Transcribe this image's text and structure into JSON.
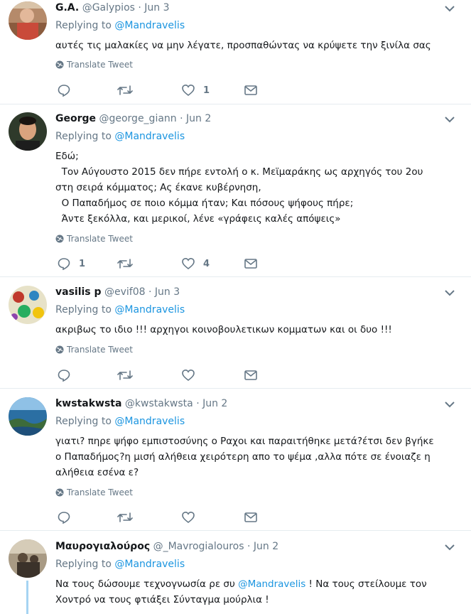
{
  "translate_label": "Translate Tweet",
  "replying_prefix": "Replying to",
  "tweets": [
    {
      "name": "G.A.",
      "handle": "@Galypios",
      "date": "Jun 3",
      "reply_to": "@Mandravelis",
      "lines": [
        "αυτές τις μαλακίες να μην λέγατε, προσπαθώντας να κρύψετε την ξινίλα σας"
      ],
      "replies": "",
      "likes": "1"
    },
    {
      "name": "George",
      "handle": "@george_giann",
      "date": "Jun 2",
      "reply_to": "@Mandravelis",
      "lines": [
        "Εδώ;",
        "  Τον Αύγουστο 2015 δεν πήρε εντολή ο κ. Μεϊμαράκης ως αρχηγός του 2ου",
        "στη σειρά κόμματος; Ας έκανε κυβέρνηση,",
        "  Ο Παπαδήμος σε ποιο κόμμα ήταν; Και πόσους ψήφους πήρε;",
        "  Άντε ξεκόλλα, και μερικοί, λένε «γράφεις καλές απόψεις»"
      ],
      "replies": "1",
      "likes": "4"
    },
    {
      "name": "vasilis p",
      "handle": "@evif08",
      "date": "Jun 3",
      "reply_to": "@Mandravelis",
      "lines": [
        "ακριβως το ιδιο !!! αρχηγοι κοινοβουλετικων κομματων και οι δυο !!!"
      ],
      "replies": "",
      "likes": ""
    },
    {
      "name": "kwstakwsta",
      "handle": "@kwstakwsta",
      "date": "Jun 2",
      "reply_to": "@Mandravelis",
      "lines": [
        "γιατι? πηρε ψήφο εμπιστοσύνης ο Ραχοι και παραιτήθηκε μετά?έτσι δεν βγήκε",
        "ο Παπαδήμος?η μισή αλήθεια χειρότερη απο το ψέμα ,αλλα πότε σε ένοιαζε η",
        "αλήθεια εσένα ε?"
      ],
      "replies": "",
      "likes": ""
    },
    {
      "name": "Μαυρογιαλούρος",
      "handle": "@_Mavrogialouros",
      "date": "Jun 2",
      "reply_to": "@Mandravelis",
      "lines_a": "Να τους δώσουμε τεχνογνωσία ρε συ ",
      "inline_mention": "@Mandravelis",
      "lines_b": " ! Να τους στείλουμε τον",
      "lines_c": "Χοντρό να τους φτιάξει Σύνταγμα μούρλια !"
    }
  ]
}
